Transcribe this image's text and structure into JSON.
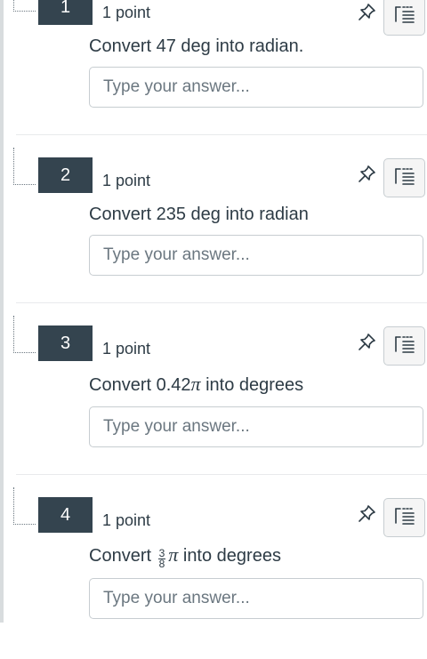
{
  "questions": [
    {
      "number": "1",
      "points": "1 point",
      "text": "Convert 47 deg into radian.",
      "placeholder": "Type your answer..."
    },
    {
      "number": "2",
      "points": "1 point",
      "text": "Convert 235 deg into radian",
      "placeholder": "Type your answer..."
    },
    {
      "number": "3",
      "points": "1 point",
      "text_prefix": "Convert 0.42",
      "pi": "π",
      "text_suffix": " into degrees",
      "placeholder": "Type your answer..."
    },
    {
      "number": "4",
      "points": "1 point",
      "text_prefix": "Convert ",
      "frac_num": "3",
      "frac_den": "8",
      "pi": "π",
      "text_suffix": " into degrees",
      "placeholder": "Type your answer..."
    }
  ],
  "icons": {
    "pin": "pin-icon",
    "notes": "notes-list-icon"
  },
  "colors": {
    "number_badge": "#34444f",
    "text": "#2d3b45",
    "border": "#c7cdd1"
  }
}
